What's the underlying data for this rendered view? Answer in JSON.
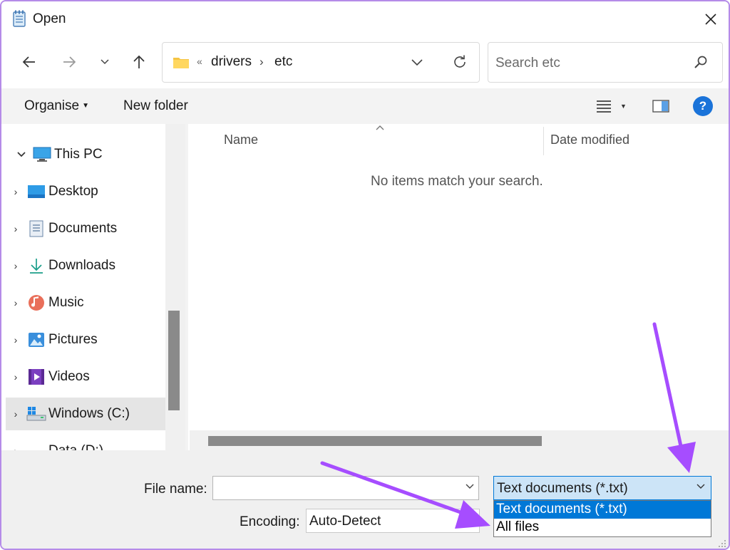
{
  "window": {
    "title": "Open",
    "close_icon": "close-icon"
  },
  "nav": {
    "back_icon": "arrow-left-icon",
    "forward_icon": "arrow-right-icon",
    "recent_icon": "chevron-down-icon",
    "up_icon": "arrow-up-icon",
    "address": {
      "overflow": "«",
      "crumbs": [
        "drivers",
        "etc"
      ],
      "chevron": "›"
    },
    "search": {
      "placeholder": "Search etc"
    }
  },
  "commandbar": {
    "organise": "Organise",
    "new_folder": "New folder",
    "help": "?"
  },
  "sidebar": {
    "items": [
      {
        "label": "This PC",
        "expanded": true,
        "icon": "computer-icon"
      },
      {
        "label": "Desktop",
        "icon": "desktop-icon"
      },
      {
        "label": "Documents",
        "icon": "documents-icon"
      },
      {
        "label": "Downloads",
        "icon": "downloads-icon"
      },
      {
        "label": "Music",
        "icon": "music-icon"
      },
      {
        "label": "Pictures",
        "icon": "pictures-icon"
      },
      {
        "label": "Videos",
        "icon": "videos-icon"
      },
      {
        "label": "Windows (C:)",
        "icon": "drive-icon",
        "selected": true
      },
      {
        "label": "Data (D:)",
        "icon": "drive-icon"
      }
    ]
  },
  "filelist": {
    "columns": [
      "Name",
      "Date modified"
    ],
    "empty_message": "No items match your search."
  },
  "footer": {
    "file_name_label": "File name:",
    "file_name_value": "",
    "encoding_label": "Encoding:",
    "encoding_value": "Auto-Detect",
    "file_type_value": "Text documents (*.txt)",
    "file_type_options": [
      "Text documents (*.txt)",
      "All files"
    ]
  },
  "colors": {
    "accent": "#0078d7",
    "annotation_arrow": "#a64dff",
    "window_border": "#b58be8"
  }
}
